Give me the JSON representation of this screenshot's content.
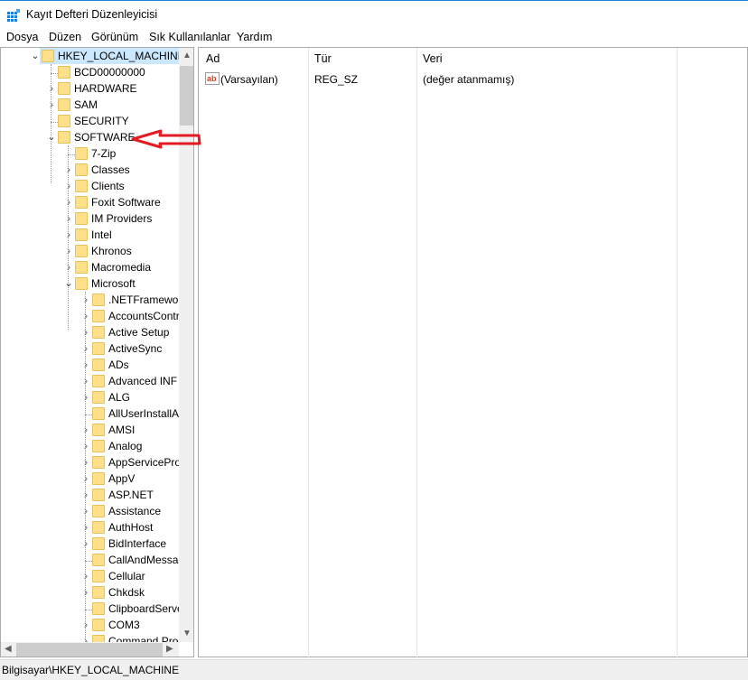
{
  "window": {
    "title": "Kayıt Defteri Düzenleyicisi",
    "icon": "registry-editor-icon"
  },
  "menu": [
    "Dosya",
    "Düzen",
    "Görünüm",
    "Sık Kullanılanlar",
    "Yardım"
  ],
  "tree": [
    {
      "label": "HKEY_LOCAL_MACHINE",
      "level": 0,
      "exp": "open",
      "selected": true
    },
    {
      "label": "BCD00000000",
      "level": 1,
      "exp": "none"
    },
    {
      "label": "HARDWARE",
      "level": 1,
      "exp": "closed"
    },
    {
      "label": "SAM",
      "level": 1,
      "exp": "closed"
    },
    {
      "label": "SECURITY",
      "level": 1,
      "exp": "none"
    },
    {
      "label": "SOFTWARE",
      "level": 1,
      "exp": "open"
    },
    {
      "label": "7-Zip",
      "level": 2,
      "exp": "none"
    },
    {
      "label": "Classes",
      "level": 2,
      "exp": "closed"
    },
    {
      "label": "Clients",
      "level": 2,
      "exp": "closed"
    },
    {
      "label": "Foxit Software",
      "level": 2,
      "exp": "closed"
    },
    {
      "label": "IM Providers",
      "level": 2,
      "exp": "closed"
    },
    {
      "label": "Intel",
      "level": 2,
      "exp": "closed"
    },
    {
      "label": "Khronos",
      "level": 2,
      "exp": "closed"
    },
    {
      "label": "Macromedia",
      "level": 2,
      "exp": "closed"
    },
    {
      "label": "Microsoft",
      "level": 2,
      "exp": "open"
    },
    {
      "label": ".NETFramework",
      "level": 3,
      "exp": "closed"
    },
    {
      "label": "AccountsControl",
      "level": 3,
      "exp": "closed"
    },
    {
      "label": "Active Setup",
      "level": 3,
      "exp": "closed"
    },
    {
      "label": "ActiveSync",
      "level": 3,
      "exp": "closed"
    },
    {
      "label": "ADs",
      "level": 3,
      "exp": "closed"
    },
    {
      "label": "Advanced INF Setup",
      "level": 3,
      "exp": "closed"
    },
    {
      "label": "ALG",
      "level": 3,
      "exp": "closed"
    },
    {
      "label": "AllUserInstallAgent",
      "level": 3,
      "exp": "none"
    },
    {
      "label": "AMSI",
      "level": 3,
      "exp": "closed"
    },
    {
      "label": "Analog",
      "level": 3,
      "exp": "closed"
    },
    {
      "label": "AppServiceProtocols",
      "level": 3,
      "exp": "closed"
    },
    {
      "label": "AppV",
      "level": 3,
      "exp": "closed"
    },
    {
      "label": "ASP.NET",
      "level": 3,
      "exp": "closed"
    },
    {
      "label": "Assistance",
      "level": 3,
      "exp": "closed"
    },
    {
      "label": "AuthHost",
      "level": 3,
      "exp": "closed"
    },
    {
      "label": "BidInterface",
      "level": 3,
      "exp": "closed"
    },
    {
      "label": "CallAndMessageEnhancement",
      "level": 3,
      "exp": "none"
    },
    {
      "label": "Cellular",
      "level": 3,
      "exp": "closed"
    },
    {
      "label": "Chkdsk",
      "level": 3,
      "exp": "closed"
    },
    {
      "label": "ClipboardServer",
      "level": 3,
      "exp": "none"
    },
    {
      "label": "COM3",
      "level": 3,
      "exp": "closed"
    },
    {
      "label": "Command Processor",
      "level": 3,
      "exp": "closed"
    }
  ],
  "list": {
    "columns": [
      "Ad",
      "Tür",
      "Veri"
    ],
    "rows": [
      {
        "name": "(Varsayılan)",
        "type": "REG_SZ",
        "data": "(değer atanmamış)",
        "icon": "string-value-icon"
      }
    ]
  },
  "status": {
    "path": "Bilgisayar\\HKEY_LOCAL_MACHINE"
  },
  "colors": {
    "selection": "#cce8ff",
    "folder": "#ffe08a",
    "annotation": "#e31b23"
  }
}
